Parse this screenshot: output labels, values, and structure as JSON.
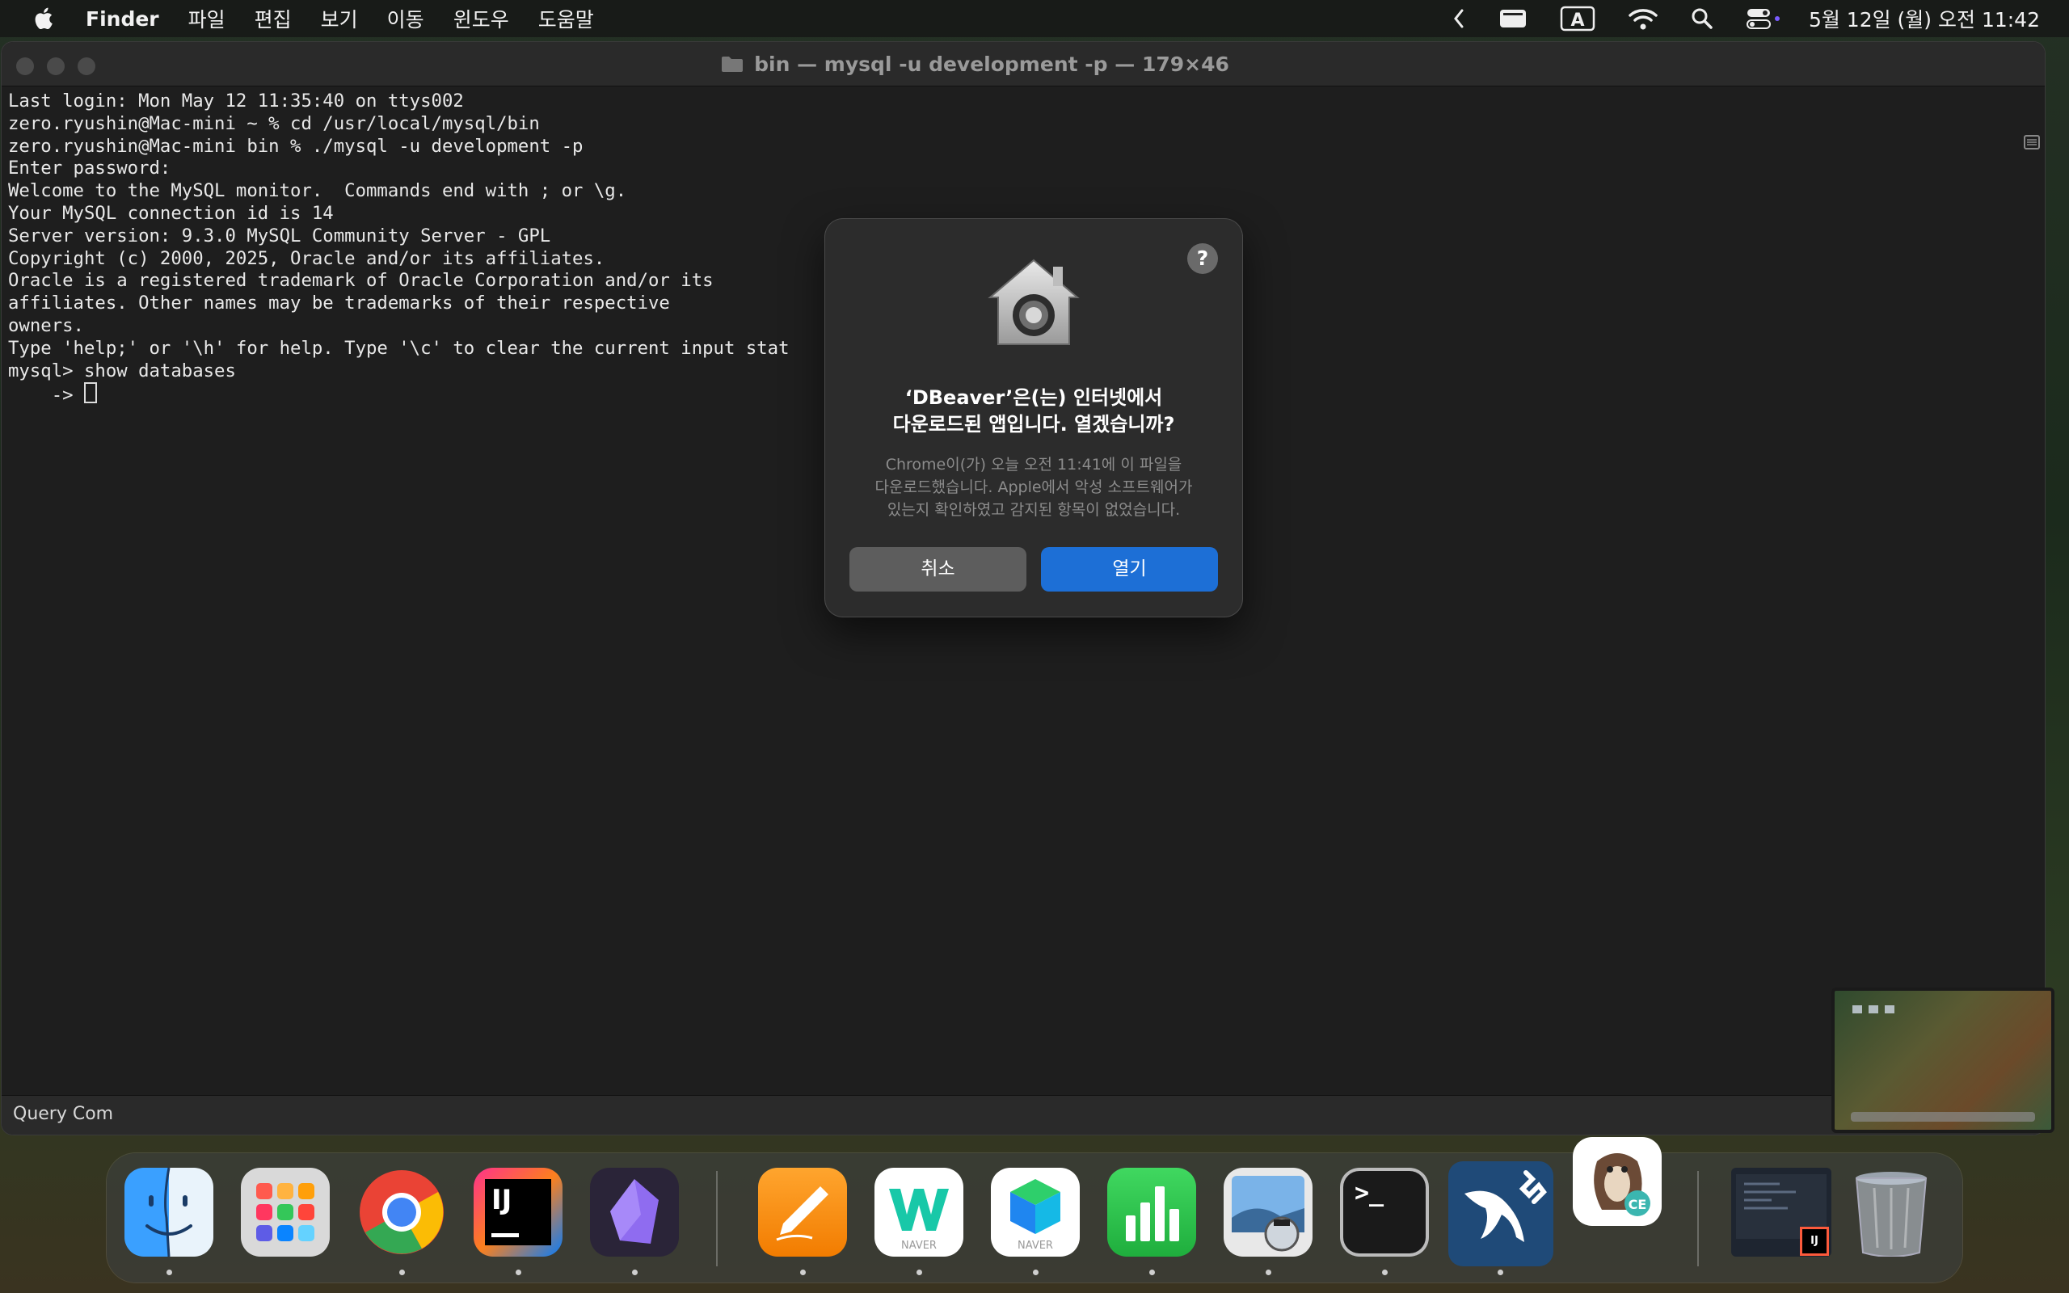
{
  "menubar": {
    "app_name": "Finder",
    "items": [
      "파일",
      "편집",
      "보기",
      "이동",
      "윈도우",
      "도움말"
    ],
    "input_indicator": "A",
    "clock": "5월 12일 (월) 오전 11:42"
  },
  "terminal": {
    "title": "bin — mysql -u development -p — 179×46",
    "lines": [
      "Last login: Mon May 12 11:35:40 on ttys002",
      "zero.ryushin@Mac-mini ~ % cd /usr/local/mysql/bin",
      "zero.ryushin@Mac-mini bin % ./mysql -u development -p",
      "Enter password:",
      "Welcome to the MySQL monitor.  Commands end with ; or \\g.",
      "Your MySQL connection id is 14",
      "Server version: 9.3.0 MySQL Community Server - GPL",
      "",
      "Copyright (c) 2000, 2025, Oracle and/or its affiliates.",
      "",
      "Oracle is a registered trademark of Oracle Corporation and/or its",
      "affiliates. Other names may be trademarks of their respective",
      "owners.",
      "",
      "Type 'help;' or '\\h' for help. Type '\\c' to clear the current input stat",
      "",
      "mysql> show databases",
      "    -> "
    ],
    "status_text": "Query Com"
  },
  "dialog": {
    "heading_line1": "‘DBeaver’은(는) 인터넷에서",
    "heading_line2": "다운로드된 앱입니다. 열겠습니까?",
    "body_line1": "Chrome이(가) 오늘 오전 11:41에 이 파일을",
    "body_line2": "다운로드했습니다. Apple에서 악성 소프트웨어가",
    "body_line3": "있는지 확인하였고 감지된 항목이 없었습니다.",
    "cancel_label": "취소",
    "open_label": "열기",
    "help_label": "?"
  },
  "dock": {
    "intellij_label": "IJ",
    "naver_label": "NAVER",
    "naver_box_label": "NAVER",
    "terminal_label": ">_",
    "dbeaver_badge": "CE",
    "mini_ij_label": "IJ"
  }
}
